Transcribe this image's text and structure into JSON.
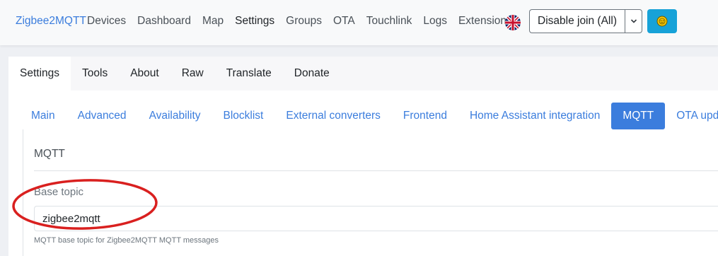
{
  "navbar": {
    "brand": "Zigbee2MQTT",
    "items": [
      {
        "label": "Devices",
        "active": false
      },
      {
        "label": "Dashboard",
        "active": false
      },
      {
        "label": "Map",
        "active": false
      },
      {
        "label": "Settings",
        "active": true
      },
      {
        "label": "Groups",
        "active": false
      },
      {
        "label": "OTA",
        "active": false
      },
      {
        "label": "Touchlink",
        "active": false
      },
      {
        "label": "Logs",
        "active": false
      },
      {
        "label": "Extensions",
        "active": false
      }
    ],
    "language_icon": "uk-flag-icon",
    "join_button": "Disable join (All)",
    "theme_icon": "sun-icon"
  },
  "settings_tabs": [
    "Settings",
    "Tools",
    "About",
    "Raw",
    "Translate",
    "Donate"
  ],
  "settings_active_tab": "Settings",
  "sub_tabs": [
    "Main",
    "Advanced",
    "Availability",
    "Blocklist",
    "External converters",
    "Frontend",
    "Home Assistant integration",
    "MQTT",
    "OTA updates"
  ],
  "sub_active_tab": "MQTT",
  "section": {
    "legend": "MQTT",
    "field_label": "Base topic",
    "field_value": "zigbee2mqtt",
    "field_help": "MQTT base topic for Zigbee2MQTT MQTT messages"
  },
  "colors": {
    "primary": "#3b7ddd",
    "annotation": "#d9201f",
    "theme_button": "#17a2d8"
  }
}
